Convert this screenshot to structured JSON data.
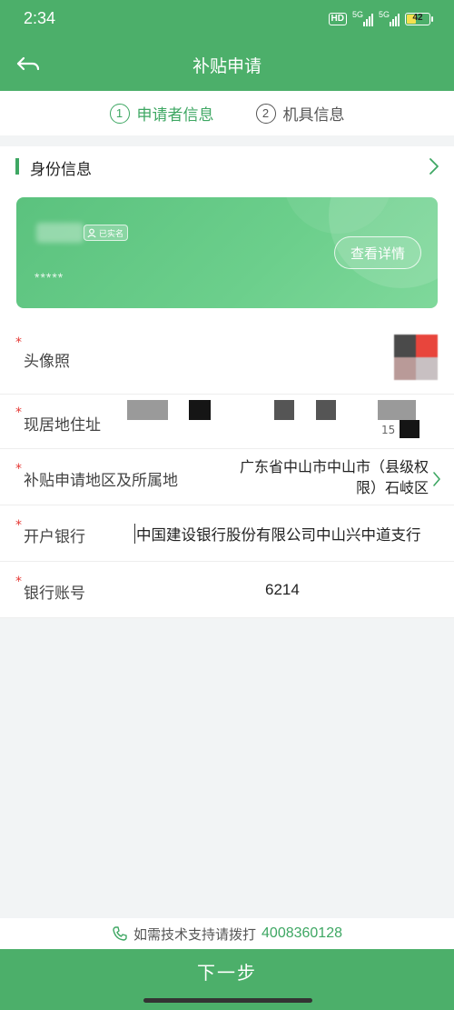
{
  "status_bar": {
    "time": "2:34",
    "network_badge": "HD",
    "network_type": "5G",
    "battery_level": "42"
  },
  "header": {
    "title": "补贴申请"
  },
  "steps": [
    {
      "number": "1",
      "label": "申请者信息",
      "active": true
    },
    {
      "number": "2",
      "label": "机具信息",
      "active": false
    }
  ],
  "identity": {
    "section_label": "身份信息",
    "verified_badge": "已实名",
    "masked_id": "*****",
    "detail_button": "查看详情"
  },
  "form": {
    "avatar_label": "头像照",
    "address_label": "现居地住址",
    "address_value_tail": "15",
    "region_label": "补贴申请地区及所属地",
    "region_value": "广东省中山市中山市（县级权限）石岐区",
    "bank_label": "开户银行",
    "bank_value": "中国建设银行股份有限公司中山兴中道支行",
    "account_label": "银行账号",
    "account_value": "6214",
    "required_mark": "*"
  },
  "footer": {
    "support_text": "如需技术支持请拨打",
    "support_phone": "4008360128",
    "next_button": "下一步"
  },
  "colors": {
    "brand_green": "#4caf6a",
    "accent_green": "#3ea763",
    "required_red": "#e53935"
  }
}
